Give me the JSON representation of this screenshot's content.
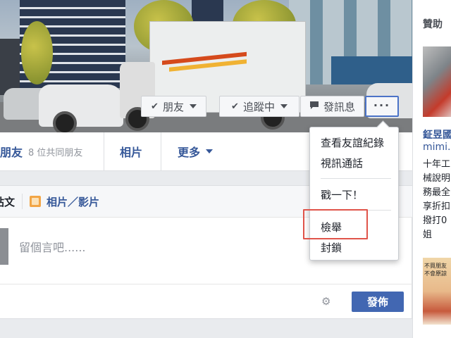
{
  "cover": {
    "friend_button": "朋友",
    "follow_button": "追蹤中",
    "message_button": "發訊息",
    "more_button": "···"
  },
  "nav": {
    "friends_label": "朋友",
    "mutual_friends": "8 位共同朋友",
    "photos_label": "相片",
    "more_label": "更多"
  },
  "composer": {
    "post_tab": "貼文",
    "photo_tab": "相片／影片",
    "placeholder": "留個言吧......",
    "publish_button": "發佈"
  },
  "menu": {
    "items": [
      "查看友誼紀錄",
      "視訊通話",
      "戳一下！",
      "檢舉",
      "封鎖"
    ],
    "highlighted": "檢舉"
  },
  "sidebar": {
    "section_title": "贊助",
    "ad_name": "鉦昱國",
    "ad_url": "mimi.i",
    "ad_lines": [
      "十年工",
      "械說明",
      "務最全",
      "享折扣",
      "撥打0",
      "姐"
    ],
    "ad2_text": [
      "不買朋友",
      "不會原諒"
    ]
  },
  "colors": {
    "link_blue": "#365899",
    "publish_blue": "#4267b2",
    "highlight_red": "#e0544a"
  }
}
